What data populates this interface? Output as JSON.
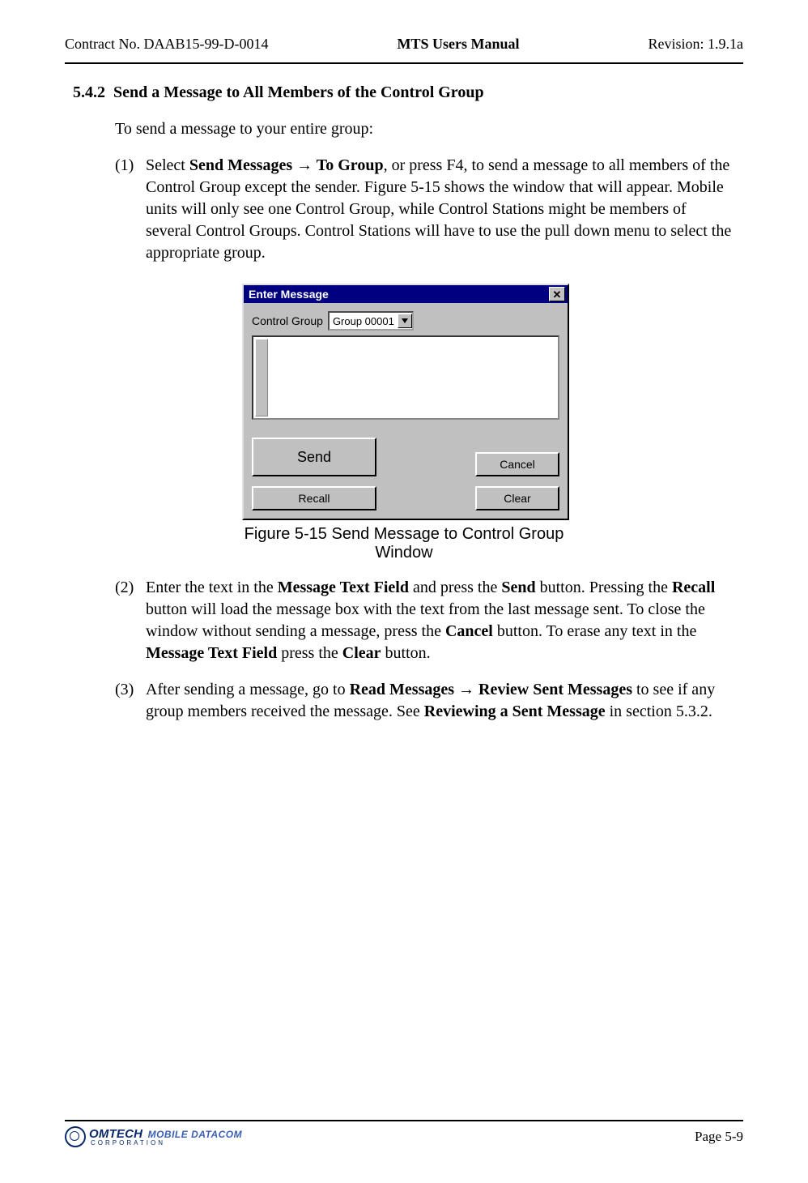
{
  "header": {
    "left": "Contract No. DAAB15-99-D-0014",
    "center": "MTS Users Manual",
    "right": "Revision:  1.9.1a"
  },
  "section": {
    "number": "5.4.2",
    "title": "Send a Message to All Members of the Control Group"
  },
  "intro": "To send a message to your entire group:",
  "step1": {
    "num": "(1)",
    "pre": "Select ",
    "bold1": "Send Messages → To Group",
    "post": ", or press F4, to send a message to all members of the Control Group except the sender.  Figure 5-15 shows the window that will appear.   Mobile units will only see one Control Group, while Control Stations might be members of several Control Groups.  Control Stations will have to use the pull down menu to select the appropriate group."
  },
  "dialog": {
    "title": "Enter Message",
    "control_group_label": "Control Group",
    "control_group_value": "Group 00001",
    "buttons": {
      "send": "Send",
      "cancel": "Cancel",
      "recall": "Recall",
      "clear": "Clear"
    }
  },
  "figure_caption": "Figure 5-15   Send Message to Control Group Window",
  "step2": {
    "num": "(2)",
    "t1": "Enter the text in the ",
    "b1": "Message Text Field",
    "t2": " and press the ",
    "b2": "Send",
    "t3": " button.  Pressing the ",
    "b3": "Recall",
    "t4": " button will load the message box with the text from the last message sent. To close the window without sending a message, press the ",
    "b4": "Cancel",
    "t5": " button. To erase any text in the ",
    "b5": "Message Text Field",
    "t6": " press the ",
    "b6": "Clear",
    "t7": " button."
  },
  "step3": {
    "num": "(3)",
    "t1": "After sending a message, go to ",
    "b1": "Read Messages → Review Sent Messages",
    "t2": " to see if any group members received the message. See ",
    "b2": "Reviewing a Sent Message",
    "t3": " in section 5.3.2."
  },
  "footer": {
    "page": "Page 5-9",
    "logo_brand": "OMTECH",
    "logo_sub1": "MOBILE DATACOM",
    "logo_sub2": "CORPORATION"
  }
}
